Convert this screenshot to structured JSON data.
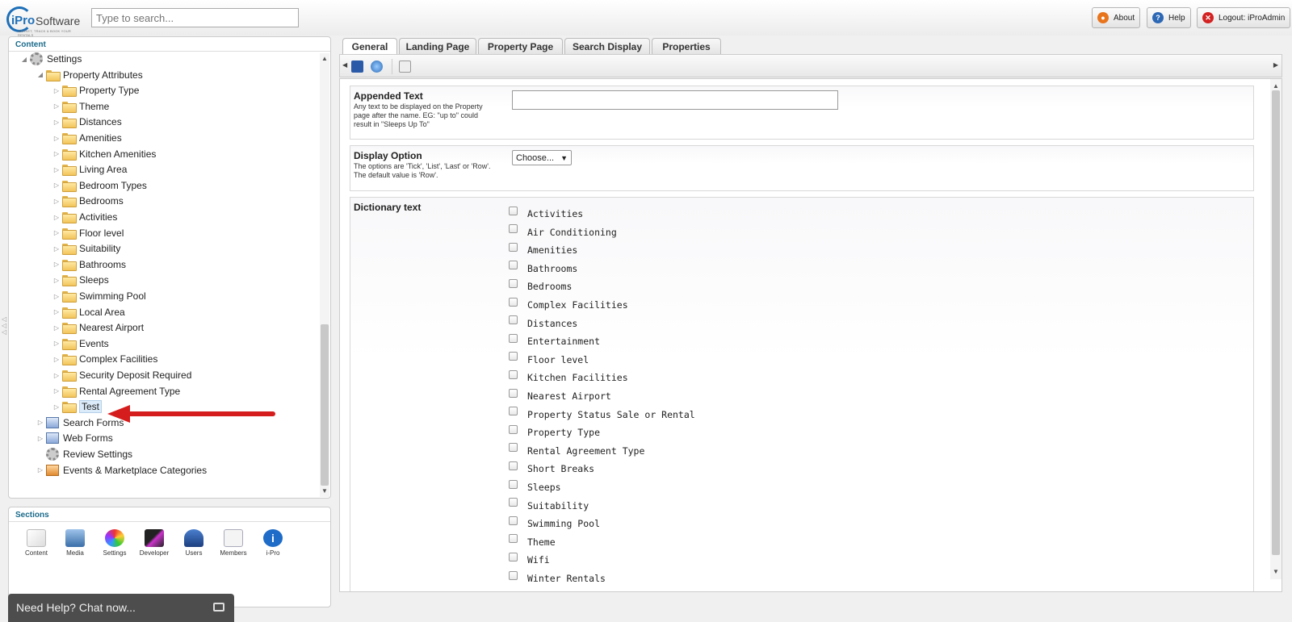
{
  "header": {
    "logo_ipro": "iPro",
    "logo_software": "Software",
    "logo_tagline": "MARKET, TRACK & BOOK YOUR RENTALS",
    "search_placeholder": "Type to search...",
    "about_label": "About",
    "help_label": "Help",
    "logout_label": "Logout: iProAdmin"
  },
  "content_panel": {
    "title": "Content",
    "tree": [
      {
        "label": "Settings",
        "icon": "gear-icon"
      },
      {
        "label": "Property Attributes",
        "icon": "folder-icon"
      },
      {
        "label": "Property Type",
        "icon": "folder-icon"
      },
      {
        "label": "Theme",
        "icon": "folder-icon"
      },
      {
        "label": "Distances",
        "icon": "folder-icon"
      },
      {
        "label": "Amenities",
        "icon": "folder-icon"
      },
      {
        "label": "Kitchen Amenities",
        "icon": "folder-icon"
      },
      {
        "label": "Living Area",
        "icon": "folder-icon"
      },
      {
        "label": "Bedroom Types",
        "icon": "folder-icon"
      },
      {
        "label": "Bedrooms",
        "icon": "folder-icon"
      },
      {
        "label": "Activities",
        "icon": "folder-icon"
      },
      {
        "label": "Floor level",
        "icon": "folder-icon"
      },
      {
        "label": "Suitability",
        "icon": "folder-icon"
      },
      {
        "label": "Bathrooms",
        "icon": "folder-icon"
      },
      {
        "label": "Sleeps",
        "icon": "folder-icon"
      },
      {
        "label": "Swimming Pool",
        "icon": "folder-icon"
      },
      {
        "label": "Local Area",
        "icon": "folder-icon"
      },
      {
        "label": "Nearest Airport",
        "icon": "folder-icon"
      },
      {
        "label": "Events",
        "icon": "folder-icon"
      },
      {
        "label": "Complex Facilities",
        "icon": "folder-icon"
      },
      {
        "label": "Security Deposit Required",
        "icon": "folder-icon"
      },
      {
        "label": "Rental Agreement Type",
        "icon": "folder-icon"
      },
      {
        "label": "Test",
        "icon": "folder-icon"
      },
      {
        "label": "Search Forms",
        "icon": "search-form-icon"
      },
      {
        "label": "Web Forms",
        "icon": "web-form-icon"
      },
      {
        "label": "Review Settings",
        "icon": "gear-icon"
      },
      {
        "label": "Events & Marketplace Categories",
        "icon": "category-icon"
      }
    ]
  },
  "sections_panel": {
    "title": "Sections",
    "items": [
      "Content",
      "Media",
      "Settings",
      "Developer",
      "Users",
      "Members",
      "i-Pro"
    ]
  },
  "chat": {
    "label": "Need Help? Chat now..."
  },
  "tabs": [
    "General",
    "Landing Page",
    "Property Page",
    "Search Display",
    "Properties"
  ],
  "fields": {
    "appended_text": {
      "label": "Appended Text",
      "description": "Any text to be displayed on the Property page after the name. EG: \"up to\" could result in \"Sleeps Up To\"",
      "value": ""
    },
    "display_option": {
      "label": "Display Option",
      "description": "The options are 'Tick', 'List', 'Last' or 'Row'. The default value is 'Row'.",
      "selected": "Choose..."
    },
    "dictionary_text": {
      "label": "Dictionary text",
      "options": [
        "Activities",
        "Air Conditioning",
        "Amenities",
        "Bathrooms",
        "Bedrooms",
        "Complex Facilities",
        "Distances",
        "Entertainment",
        "Floor level",
        "Kitchen Facilities",
        "Nearest Airport",
        "Property Status Sale or Rental",
        "Property Type",
        "Rental Agreement Type",
        "Short Breaks",
        "Sleeps",
        "Suitability",
        "Swimming Pool",
        "Theme",
        "Wifi",
        "Winter Rentals"
      ]
    }
  },
  "colors": {
    "accent": "#1a6a8a",
    "annotation_arrow": "#e0201c"
  }
}
